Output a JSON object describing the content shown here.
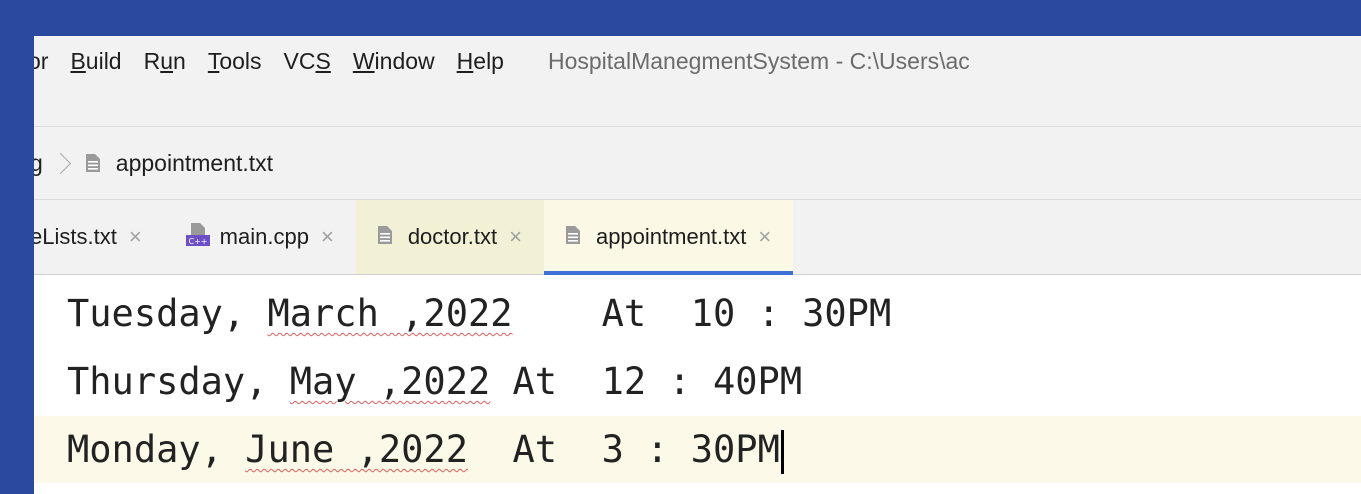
{
  "menubar": {
    "items": [
      {
        "label": "or",
        "hot": ""
      },
      {
        "label_pre": "",
        "hot": "B",
        "label_post": "uild"
      },
      {
        "label_pre": "R",
        "hot": "u",
        "label_post": "n"
      },
      {
        "label_pre": "",
        "hot": "T",
        "label_post": "ools"
      },
      {
        "label_pre": "VC",
        "hot": "S",
        "label_post": ""
      },
      {
        "label_pre": "",
        "hot": "W",
        "label_post": "indow"
      },
      {
        "label_pre": "",
        "hot": "H",
        "label_post": "elp"
      }
    ],
    "title": "HospitalManegmentSystem - C:\\Users\\ac"
  },
  "breadcrumb": {
    "first": "g",
    "file": "appointment.txt"
  },
  "tabs": [
    {
      "label": "eLists.txt",
      "close": "×"
    },
    {
      "label": "main.cpp",
      "close": "×"
    },
    {
      "label": "doctor.txt",
      "close": "×"
    },
    {
      "label": "appointment.txt",
      "close": "×"
    }
  ],
  "editor": {
    "lines": [
      {
        "day": "Tuesday, ",
        "month": "March ,2022",
        "rest": "    At  10 : 30PM"
      },
      {
        "day": "Thursday, ",
        "month": "May ,2022",
        "rest": " At  12 : 40PM"
      },
      {
        "day": "Monday, ",
        "month": "June ,2022",
        "rest": "  At  3 : 30PM"
      }
    ]
  },
  "colors": {
    "accent": "#3d6fd6",
    "background": "#2b4a9f"
  }
}
